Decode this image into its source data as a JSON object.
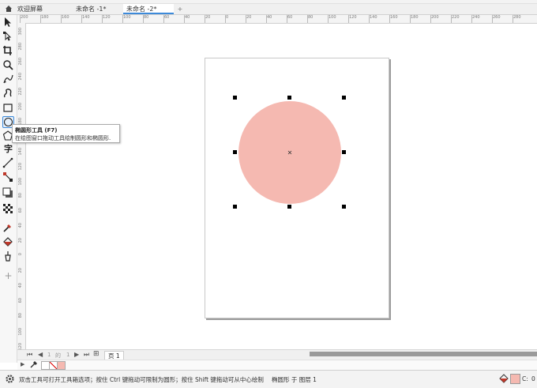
{
  "tabs": {
    "welcome": "欢迎屏幕",
    "doc1": "未命名 -1*",
    "doc2": "未命名 -2*",
    "add": "+"
  },
  "ruler": {
    "h_ticks": [
      "200",
      "180",
      "160",
      "140",
      "120",
      "100",
      "80",
      "60",
      "40",
      "20",
      "0",
      "20",
      "40",
      "60",
      "80",
      "100",
      "120",
      "140",
      "160",
      "180",
      "200",
      "220",
      "240",
      "260",
      "280"
    ],
    "v_ticks": [
      "300",
      "280",
      "260",
      "240",
      "220",
      "200",
      "180",
      "160",
      "140",
      "120",
      "100",
      "80",
      "60",
      "40",
      "20",
      "0",
      "20",
      "40",
      "60",
      "80",
      "100",
      "120"
    ]
  },
  "tooltip": {
    "title": "椭圆形工具 (F7)",
    "desc": "在绘图窗口拖动工具绘制圆形和椭圆形."
  },
  "tools": [
    "pick-tool",
    "shape-tool",
    "crop-tool",
    "zoom-tool",
    "freehand-tool",
    "artistic-media-tool",
    "rectangle-tool",
    "ellipse-tool",
    "polygon-tool",
    "text-tool",
    "parallel-dimension-tool",
    "connector-tool",
    "drop-shadow-tool",
    "transparency-tool",
    "eyedropper-tool",
    "interactive-fill-tool",
    "smart-fill-tool",
    "add-tool"
  ],
  "pagebar": {
    "page_current": "1",
    "page_of": "的",
    "page_total": "1",
    "page_tab": "页 1"
  },
  "status": {
    "hint": "双击工具可打开工具箱选项；按住 Ctrl 键拖动可限制为圆形；按住 Shift 键拖动可从中心绘制",
    "object_info": "椭圆形 于 图层 1",
    "fill_label": "C:",
    "fill_value": "0"
  },
  "colors": {
    "ellipse_fill": "#f5b9b1",
    "accent": "#3d8ad9"
  },
  "shape": {
    "type": "ellipse",
    "selected": true
  }
}
